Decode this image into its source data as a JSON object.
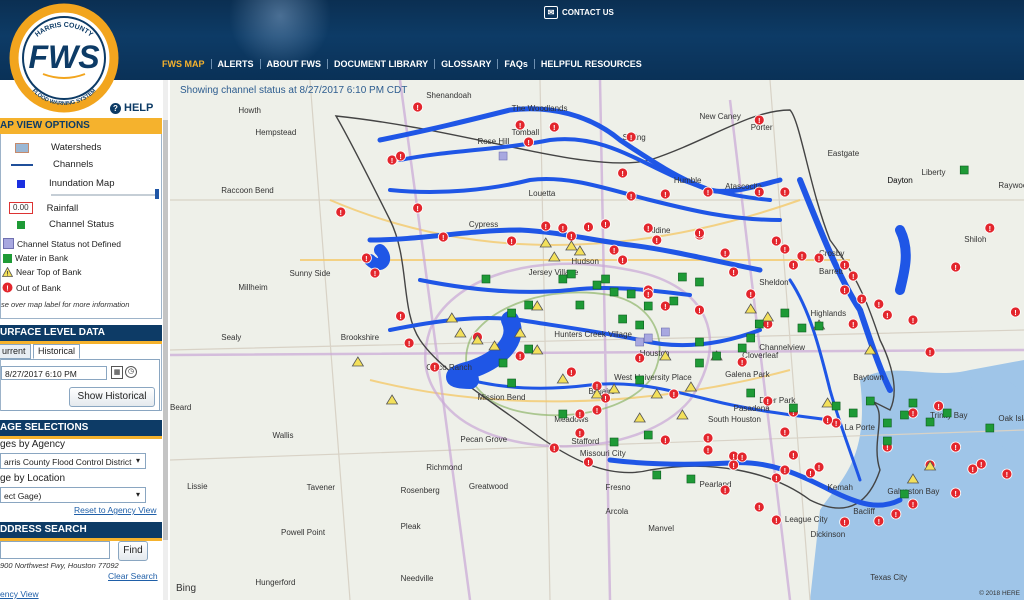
{
  "header": {
    "contact": "CONTACT US",
    "logo_text": "FWS",
    "logo_ring_top": "HARRIS COUNTY",
    "logo_ring_bottom": "FLOOD WARNING SYSTEM",
    "nav": [
      "FWS MAP",
      "ALERTS",
      "ABOUT FWS",
      "DOCUMENT LIBRARY",
      "GLOSSARY",
      "FAQs",
      "HELPFUL RESOURCES"
    ]
  },
  "panel": {
    "help": "HELP",
    "map_view": {
      "title": "AP VIEW OPTIONS",
      "watersheds": "Watersheds",
      "channels": "Channels",
      "inundation": "Inundation Map",
      "rainfall_value": "0.00",
      "rainfall": "Rainfall",
      "channel_status": "Channel Status",
      "not_defined": "Channel Status not Defined",
      "water_in_bank": "Water in Bank",
      "near_top": "Near Top of Bank",
      "out_of_bank": "Out of Bank",
      "hint": "se over map label for more information"
    },
    "surface": {
      "title": "URFACE LEVEL DATA",
      "tab_current": "urrent",
      "tab_historical": "Historical",
      "datetime": "8/27/2017 6:10 PM",
      "show_historical": "Show Historical"
    },
    "gage": {
      "title": "AGE SELECTIONS",
      "by_agency": "ges by Agency",
      "agency_value": "arris County Flood Control District",
      "by_location": "ge by Location",
      "location_value": "ect Gage)",
      "reset": "Reset to Agency View"
    },
    "address": {
      "title": "DDRESS SEARCH",
      "find": "Find",
      "example": "900 Northwest Fwy, Houston 77092",
      "clear": "Clear Search",
      "agency_view": "ency View"
    }
  },
  "map": {
    "status": "Showing channel status at 8/27/2017 6:10 PM CDT",
    "copyright": "© 2018 HERE",
    "bing": "Bing",
    "colors": {
      "water": "#1f56e6",
      "out": "#e3262d",
      "near": "#f3e05b",
      "in_bank": "#1e9a36",
      "undef": "#a8a8e0"
    },
    "places": [
      [
        "Shenandoah",
        30,
        18
      ],
      [
        "The Woodlands",
        40,
        31
      ],
      [
        "Howth",
        8,
        33
      ],
      [
        "New Caney",
        62,
        39
      ],
      [
        "Hempstead",
        10,
        55
      ],
      [
        "Tomball",
        40,
        55
      ],
      [
        "Spring",
        53,
        60
      ],
      [
        "Rose Hill",
        36,
        64
      ],
      [
        "Porter",
        68,
        50
      ],
      [
        "Eastgate",
        77,
        76
      ],
      [
        "Dayton",
        84,
        103
      ],
      [
        "Liberty",
        88,
        95
      ],
      [
        "Raccoon Bend",
        6,
        113
      ],
      [
        "Humble",
        59,
        103
      ],
      [
        "Atascocita",
        65,
        109
      ],
      [
        "Cypress",
        35,
        147
      ],
      [
        "Louetta",
        42,
        116
      ],
      [
        "Aldine",
        56,
        153
      ],
      [
        "Crosby",
        76,
        176
      ],
      [
        "Sheldon",
        69,
        205
      ],
      [
        "Hudson",
        47,
        184
      ],
      [
        "Jersey Village",
        42,
        195
      ],
      [
        "Millheim",
        8,
        210
      ],
      [
        "Sunny Side",
        14,
        196
      ],
      [
        "Barrett",
        76,
        194
      ],
      [
        "Highlands",
        75,
        236
      ],
      [
        "Sealy",
        6,
        260
      ],
      [
        "Brookshire",
        20,
        260
      ],
      [
        "Hunters Creek Village",
        45,
        257
      ],
      [
        "Houston",
        55,
        276
      ],
      [
        "Channelview",
        69,
        270
      ],
      [
        "Cloverleaf",
        67,
        278
      ],
      [
        "Cinco Ranch",
        30,
        290
      ],
      [
        "West University Place",
        52,
        300
      ],
      [
        "Galena Park",
        65,
        297
      ],
      [
        "Baytown",
        80,
        300
      ],
      [
        "Mission Bend",
        36,
        320
      ],
      [
        "Deer Park",
        69,
        323
      ],
      [
        "Beard",
        0,
        330
      ],
      [
        "Bellaire",
        49,
        314
      ],
      [
        "South Houston",
        63,
        342
      ],
      [
        "Trinity Bay",
        89,
        338
      ],
      [
        "Oak Island",
        97,
        341
      ],
      [
        "Wallis",
        12,
        358
      ],
      [
        "Pecan Grove",
        34,
        362
      ],
      [
        "Meadows",
        45,
        342
      ],
      [
        "Stafford",
        47,
        364
      ],
      [
        "Missouri City",
        48,
        376
      ],
      [
        "La Porte",
        79,
        350
      ],
      [
        "Richmond",
        30,
        390
      ],
      [
        "Pasadena",
        66,
        331
      ],
      [
        "Galveston Bay",
        84,
        414
      ],
      [
        "Lissie",
        2,
        409
      ],
      [
        "Tavener",
        16,
        410
      ],
      [
        "Rosenberg",
        27,
        413
      ],
      [
        "Greatwood",
        35,
        409
      ],
      [
        "Fresno",
        51,
        410
      ],
      [
        "Arcola",
        51,
        434
      ],
      [
        "Manvel",
        56,
        451
      ],
      [
        "Pearland",
        62,
        407
      ],
      [
        "League City",
        72,
        442
      ],
      [
        "Bacliff",
        80,
        434
      ],
      [
        "Kemah",
        77,
        410
      ],
      [
        "Dickinson",
        75,
        457
      ],
      [
        "Pleak",
        27,
        449
      ],
      [
        "Powell Point",
        13,
        455
      ],
      [
        "Hungerford",
        10,
        505
      ],
      [
        "Needville",
        27,
        501
      ],
      [
        "Texas City",
        82,
        500
      ],
      [
        "Dayton",
        84,
        103
      ],
      [
        "Shiloh",
        93,
        162
      ],
      [
        "Raywood",
        97,
        108
      ]
    ],
    "markers": [
      [
        "o",
        29,
        27
      ],
      [
        "o",
        41,
        45
      ],
      [
        "o",
        42,
        62
      ],
      [
        "o",
        54,
        57
      ],
      [
        "o",
        69,
        40
      ],
      [
        "o",
        45,
        47
      ],
      [
        "o",
        26,
        80
      ],
      [
        "o",
        58,
        114
      ],
      [
        "o",
        53,
        93
      ],
      [
        "o",
        44,
        146
      ],
      [
        "o",
        54,
        116
      ],
      [
        "o",
        63,
        112
      ],
      [
        "o",
        62,
        155
      ],
      [
        "o",
        69,
        112
      ],
      [
        "o",
        72,
        112
      ],
      [
        "o",
        62,
        153
      ],
      [
        "o",
        27,
        76
      ],
      [
        "o",
        29,
        128
      ],
      [
        "o",
        40,
        161
      ],
      [
        "o",
        32,
        157
      ],
      [
        "o",
        20,
        132
      ],
      [
        "o",
        24,
        193
      ],
      [
        "o",
        23,
        178
      ],
      [
        "o",
        27,
        236
      ],
      [
        "o",
        47,
        156
      ],
      [
        "o",
        46,
        148
      ],
      [
        "o",
        49,
        147
      ],
      [
        "o",
        51,
        144
      ],
      [
        "o",
        56,
        148
      ],
      [
        "o",
        57,
        160
      ],
      [
        "o",
        52,
        170
      ],
      [
        "o",
        53,
        180
      ],
      [
        "o",
        56,
        210
      ],
      [
        "o",
        56,
        214
      ],
      [
        "o",
        58,
        226
      ],
      [
        "o",
        62,
        230
      ],
      [
        "o",
        65,
        173
      ],
      [
        "o",
        66,
        192
      ],
      [
        "o",
        68,
        214
      ],
      [
        "o",
        71,
        161
      ],
      [
        "o",
        72,
        169
      ],
      [
        "o",
        74,
        176
      ],
      [
        "o",
        73,
        185
      ],
      [
        "o",
        76,
        178
      ],
      [
        "o",
        79,
        185
      ],
      [
        "o",
        80,
        196
      ],
      [
        "o",
        79,
        210
      ],
      [
        "o",
        81,
        219
      ],
      [
        "o",
        83,
        224
      ],
      [
        "o",
        84,
        235
      ],
      [
        "o",
        87,
        240
      ],
      [
        "o",
        96,
        148
      ],
      [
        "o",
        99,
        232
      ],
      [
        "o",
        92,
        187
      ],
      [
        "o",
        89,
        272
      ],
      [
        "o",
        80,
        244
      ],
      [
        "o",
        70,
        244
      ],
      [
        "o",
        67,
        282
      ],
      [
        "o",
        55,
        278
      ],
      [
        "o",
        47,
        292
      ],
      [
        "o",
        41,
        276
      ],
      [
        "o",
        36,
        257
      ],
      [
        "o",
        50,
        306
      ],
      [
        "o",
        50,
        330
      ],
      [
        "o",
        48,
        353
      ],
      [
        "o",
        45,
        368
      ],
      [
        "o",
        49,
        382
      ],
      [
        "o",
        58,
        360
      ],
      [
        "o",
        63,
        370
      ],
      [
        "o",
        66,
        376
      ],
      [
        "o",
        72,
        352
      ],
      [
        "o",
        78,
        343
      ],
      [
        "o",
        87,
        333
      ],
      [
        "o",
        90,
        326
      ],
      [
        "o",
        92,
        367
      ],
      [
        "o",
        94,
        389
      ],
      [
        "o",
        92,
        413
      ],
      [
        "o",
        87,
        424
      ],
      [
        "o",
        85,
        434
      ],
      [
        "o",
        79,
        442
      ],
      [
        "o",
        71,
        440
      ],
      [
        "o",
        69,
        427
      ],
      [
        "o",
        65,
        410
      ],
      [
        "o",
        66,
        385
      ],
      [
        "o",
        67,
        377
      ],
      [
        "o",
        71,
        398
      ],
      [
        "o",
        72,
        390
      ],
      [
        "o",
        73,
        375
      ],
      [
        "o",
        75,
        393
      ],
      [
        "o",
        76,
        387
      ],
      [
        "o",
        89,
        385
      ],
      [
        "o",
        83,
        441
      ],
      [
        "o",
        98,
        394
      ],
      [
        "o",
        95,
        384
      ],
      [
        "o",
        84,
        367
      ],
      [
        "o",
        28,
        263
      ],
      [
        "o",
        31,
        287
      ],
      [
        "o",
        48,
        334
      ],
      [
        "o",
        51,
        318
      ],
      [
        "o",
        63,
        358
      ],
      [
        "o",
        70,
        321
      ],
      [
        "o",
        73,
        332
      ],
      [
        "o",
        77,
        340
      ],
      [
        "o",
        59,
        314
      ],
      [
        "w",
        44,
        163
      ],
      [
        "w",
        45,
        177
      ],
      [
        "w",
        47,
        166
      ],
      [
        "w",
        48,
        171
      ],
      [
        "w",
        33,
        238
      ],
      [
        "w",
        36,
        260
      ],
      [
        "w",
        38,
        266
      ],
      [
        "w",
        34,
        253
      ],
      [
        "w",
        41,
        253
      ],
      [
        "w",
        43,
        226
      ],
      [
        "w",
        43,
        270
      ],
      [
        "w",
        46,
        299
      ],
      [
        "w",
        50,
        314
      ],
      [
        "w",
        52,
        309
      ],
      [
        "w",
        55,
        338
      ],
      [
        "w",
        58,
        276
      ],
      [
        "w",
        68,
        229
      ],
      [
        "w",
        70,
        237
      ],
      [
        "w",
        76,
        245
      ],
      [
        "w",
        82,
        270
      ],
      [
        "w",
        77,
        323
      ],
      [
        "w",
        61,
        307
      ],
      [
        "w",
        87,
        399
      ],
      [
        "w",
        89,
        386
      ],
      [
        "w",
        64,
        276
      ],
      [
        "w",
        22,
        282
      ],
      [
        "w",
        26,
        320
      ],
      [
        "w",
        57,
        314
      ],
      [
        "w",
        60,
        335
      ],
      [
        "g",
        37,
        199
      ],
      [
        "g",
        40,
        233
      ],
      [
        "g",
        42,
        225
      ],
      [
        "g",
        46,
        199
      ],
      [
        "g",
        47,
        194
      ],
      [
        "g",
        50,
        205
      ],
      [
        "g",
        52,
        212
      ],
      [
        "g",
        54,
        214
      ],
      [
        "g",
        55,
        245
      ],
      [
        "g",
        56,
        226
      ],
      [
        "g",
        59,
        221
      ],
      [
        "g",
        62,
        262
      ],
      [
        "g",
        64,
        276
      ],
      [
        "g",
        69,
        244
      ],
      [
        "g",
        72,
        233
      ],
      [
        "g",
        74,
        248
      ],
      [
        "g",
        76,
        246
      ],
      [
        "g",
        78,
        326
      ],
      [
        "g",
        80,
        333
      ],
      [
        "g",
        82,
        321
      ],
      [
        "g",
        84,
        343
      ],
      [
        "g",
        86,
        335
      ],
      [
        "g",
        84,
        361
      ],
      [
        "g",
        91,
        333
      ],
      [
        "g",
        89,
        342
      ],
      [
        "g",
        96,
        348
      ],
      [
        "g",
        67,
        268
      ],
      [
        "g",
        68,
        258
      ],
      [
        "g",
        62,
        283
      ],
      [
        "g",
        55,
        300
      ],
      [
        "g",
        42,
        269
      ],
      [
        "g",
        39,
        283
      ],
      [
        "g",
        40,
        303
      ],
      [
        "g",
        46,
        334
      ],
      [
        "g",
        52,
        362
      ],
      [
        "g",
        56,
        355
      ],
      [
        "g",
        68,
        313
      ],
      [
        "g",
        73,
        328
      ],
      [
        "g",
        57,
        395
      ],
      [
        "g",
        61,
        399
      ],
      [
        "g",
        93,
        90
      ],
      [
        "g",
        86,
        414
      ],
      [
        "g",
        87,
        323
      ],
      [
        "g",
        53,
        239
      ],
      [
        "g",
        51,
        199
      ],
      [
        "g",
        60,
        197
      ],
      [
        "g",
        62,
        202
      ],
      [
        "g",
        48,
        225
      ],
      [
        "u",
        39,
        76
      ],
      [
        "u",
        55,
        262
      ],
      [
        "u",
        56,
        258
      ],
      [
        "u",
        58,
        252
      ]
    ]
  }
}
